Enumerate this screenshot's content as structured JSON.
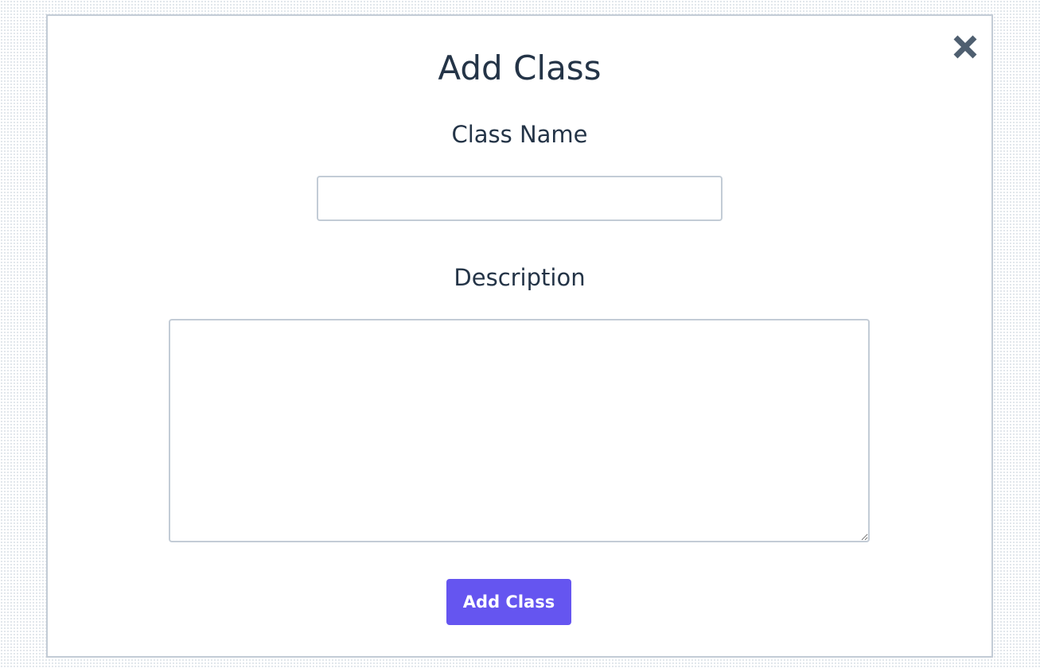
{
  "modal": {
    "title": "Add Class",
    "close_icon": "close-icon",
    "class_name": {
      "label": "Class Name",
      "value": "",
      "placeholder": ""
    },
    "description": {
      "label": "Description",
      "value": "",
      "placeholder": ""
    },
    "submit_label": "Add Class"
  },
  "colors": {
    "accent": "#6555f0",
    "text": "#243447",
    "border": "#c3ccd6",
    "close_icon": "#4f5f70"
  }
}
